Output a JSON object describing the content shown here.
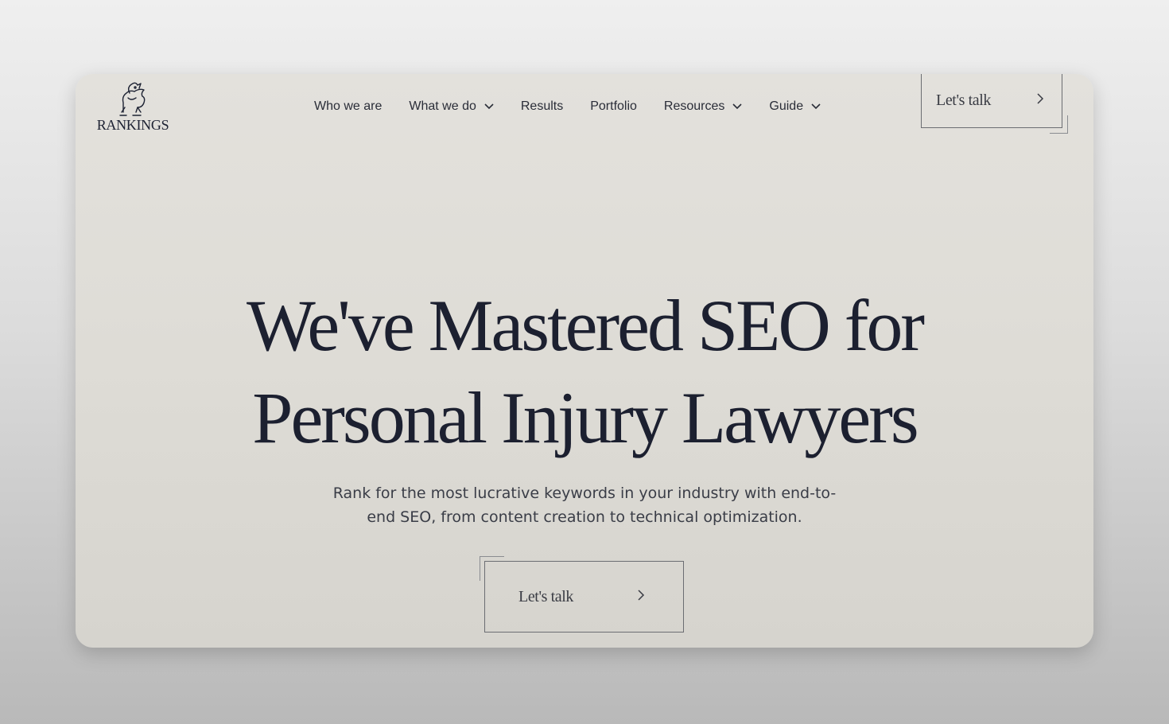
{
  "brand": {
    "name": "RANKINGS"
  },
  "nav": {
    "items": [
      {
        "label": "Who we are",
        "has_dropdown": false
      },
      {
        "label": "What we do",
        "has_dropdown": true
      },
      {
        "label": "Results",
        "has_dropdown": false
      },
      {
        "label": "Portfolio",
        "has_dropdown": false
      },
      {
        "label": "Resources",
        "has_dropdown": true
      },
      {
        "label": "Guide",
        "has_dropdown": true
      }
    ],
    "cta_label": "Let's talk"
  },
  "hero": {
    "title_line1": "We've Mastered SEO for",
    "title_line2": "Personal Injury Lawyers",
    "subtitle_line1": "Rank for the most lucrative keywords in your industry with end-to-",
    "subtitle_line2": "end SEO, from content creation to technical optimization.",
    "cta_label": "Let's talk"
  },
  "colors": {
    "text": "#1c2030",
    "background": "#e0ded8",
    "border": "#6b6d72"
  },
  "icons": {
    "logo": "griffin-logo-icon",
    "dropdown": "chevron-down-icon",
    "cta": "chevron-right-icon"
  }
}
